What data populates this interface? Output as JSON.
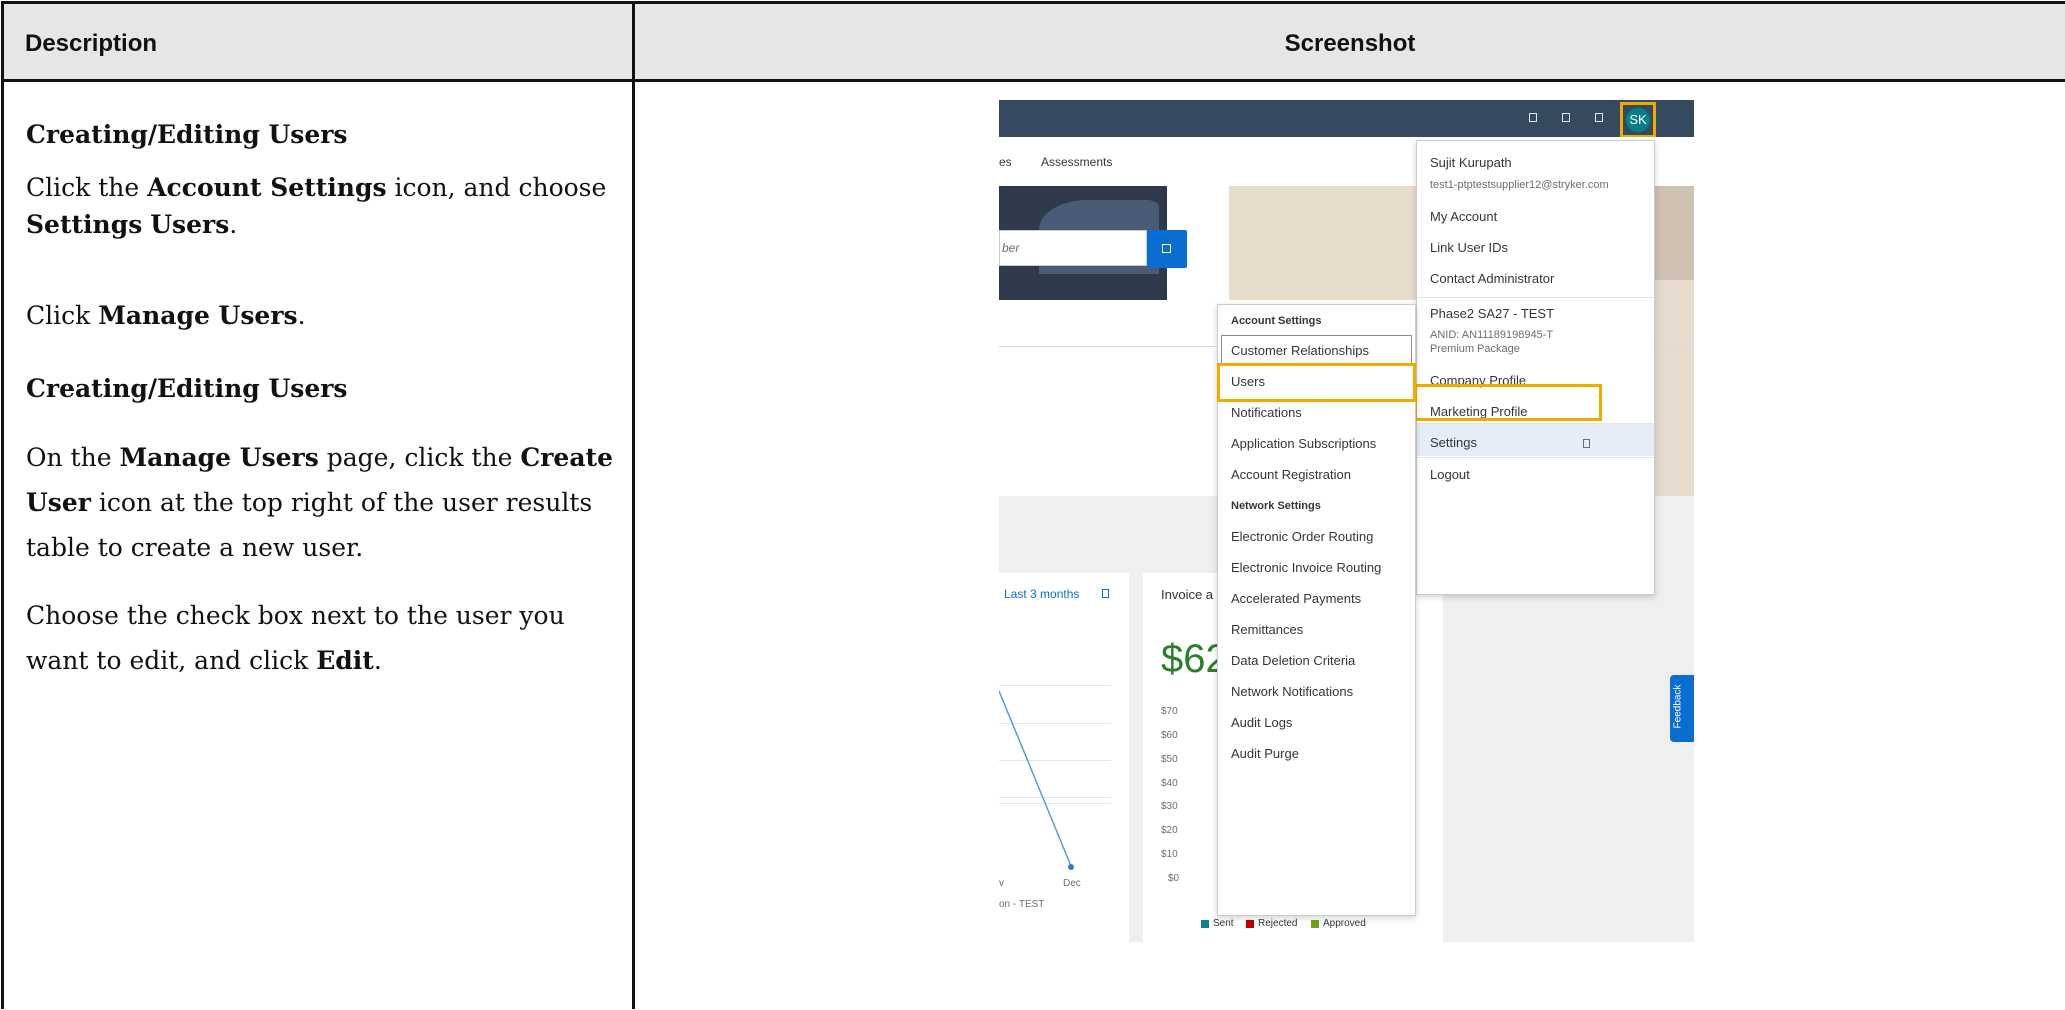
{
  "table": {
    "header_description": "Description",
    "header_screenshot": "Screenshot"
  },
  "description": {
    "heading1": "Creating/Editing Users",
    "p1_a": "Click the ",
    "p1_b": "Account Settings",
    "p1_c": " icon, and choose ",
    "p1_d": "Settings",
    "p1_e": "Users",
    "p1_f": ".",
    "p2_a": "Click ",
    "p2_b": "Manage Users",
    "p2_c": ".",
    "heading2": "Creating/Editing Users",
    "p3_a": "On the ",
    "p3_b": "Manage Users",
    "p3_c": " page, click the ",
    "p3_d": "Create User",
    "p3_e": " icon at the top right of the user results table to create a new user.",
    "p4_a": "Choose the check box next to the user you want to edit, and click ",
    "p4_b": "Edit",
    "p4_c": "."
  },
  "screenshot": {
    "avatar_initials": "SK",
    "nav_partial": "es",
    "nav_assessments": "Assessments",
    "search_placeholder": "ber",
    "link_last3": "Last 3 months",
    "invoice_partial": "Invoice a",
    "big_number": "$62",
    "y_ticks": [
      "$70",
      "$60",
      "$50",
      "$40",
      "$30",
      "$20",
      "$10",
      "$0"
    ],
    "x_tick_partial": "v",
    "x_tick_dec": "Dec",
    "footer_partial": "on - TEST",
    "legend_sent": "Sent",
    "legend_rejected": "Rejected",
    "legend_approved": "Approved",
    "feedback": "Feedback",
    "user_menu": {
      "name": "Sujit Kurupath",
      "email": "test1-ptptestsupplier12@stryker.com",
      "my_account": "My Account",
      "link_user_ids": "Link User IDs",
      "contact_admin": "Contact Administrator",
      "org": "Phase2 SA27 - TEST",
      "anid": "ANID: AN11189198945-T",
      "package": "Premium Package",
      "company_profile": "Company Profile",
      "marketing_profile": "Marketing Profile",
      "settings": "Settings",
      "logout": "Logout"
    },
    "settings_menu": {
      "account_header": "Account Settings",
      "customer_relationships": "Customer Relationships",
      "users": "Users",
      "notifications": "Notifications",
      "app_subscriptions": "Application Subscriptions",
      "account_registration": "Account Registration",
      "network_header": "Network Settings",
      "eor": "Electronic Order Routing",
      "eir": "Electronic Invoice Routing",
      "accel": "Accelerated Payments",
      "remittances": "Remittances",
      "ddc": "Data Deletion Criteria",
      "network_notifications": "Network Notifications",
      "audit_logs": "Audit Logs",
      "audit_purge": "Audit Purge"
    },
    "colors": {
      "shell": "#354a5f",
      "highlight": "#f0ab00",
      "accent": "#0a6ed1",
      "sent": "#0f828f",
      "rejected": "#bb0000",
      "approved": "#6fa21a"
    }
  }
}
